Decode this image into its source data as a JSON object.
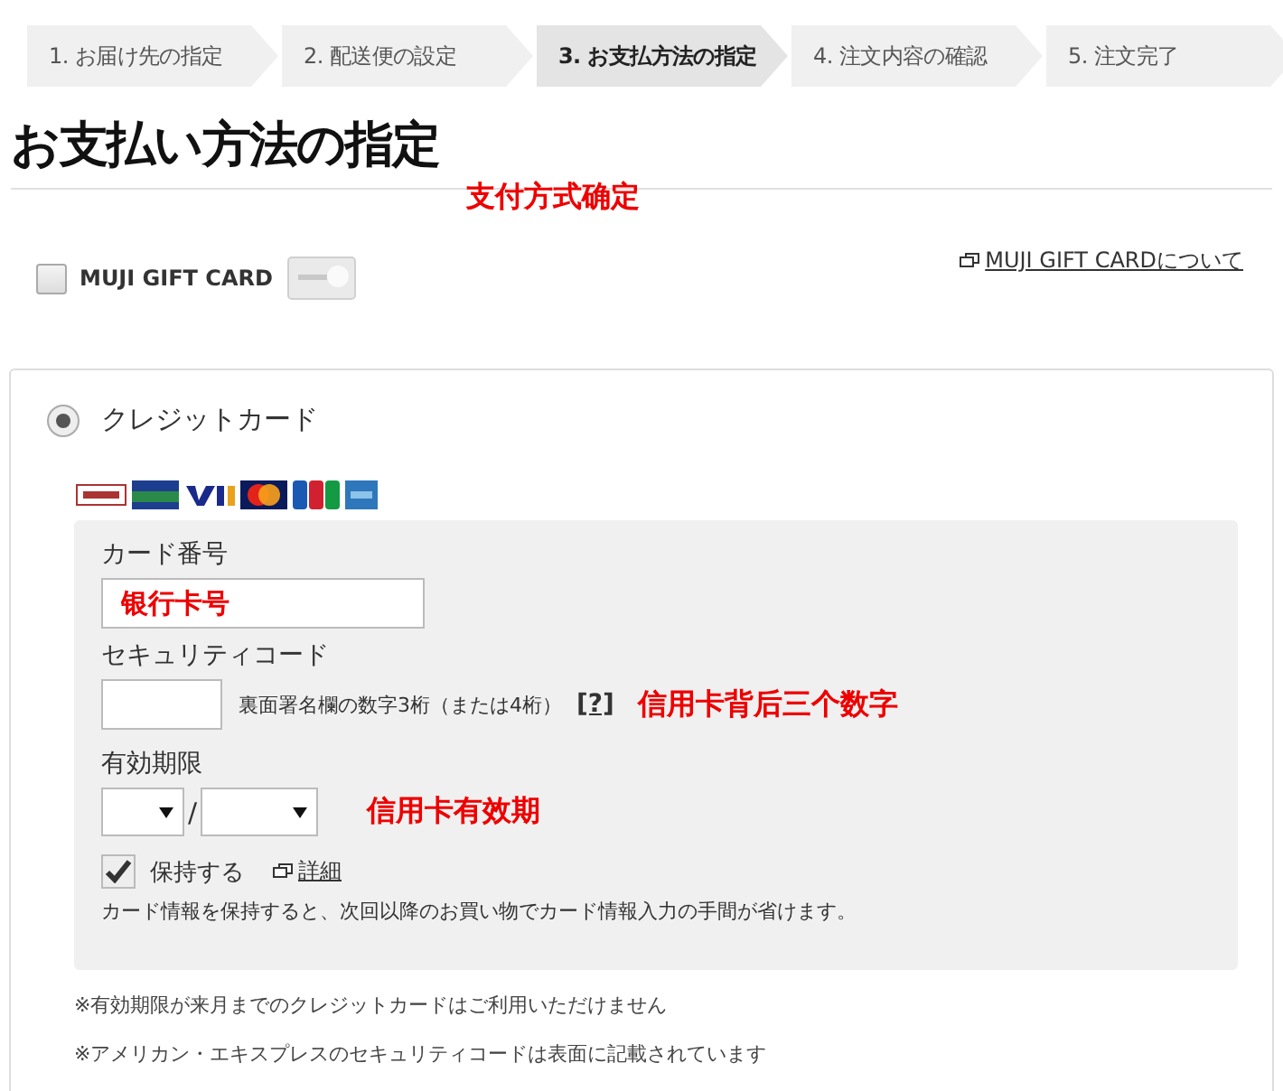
{
  "steps": [
    {
      "label": "1. お届け先の指定",
      "selected": false
    },
    {
      "label": "2. 配送便の設定",
      "selected": false
    },
    {
      "label": "3. お支払方法の指定",
      "selected": true
    },
    {
      "label": "4. 注文内容の確認",
      "selected": false
    },
    {
      "label": "5. 注文完了",
      "selected": false
    }
  ],
  "heading": "お支払い方法の指定",
  "heading_note": "支付方式确定",
  "gift_card": {
    "label": "MUJI GIFT CARD",
    "checked": false,
    "link": "MUJI GIFT CARDについて"
  },
  "payment": {
    "label": "クレジットカード",
    "selected": true,
    "card_number": {
      "label": "カード番号",
      "value": "银行卡号"
    },
    "security_code": {
      "label": "セキュリティコード",
      "hint": "裏面署名欄の数字3桁（または4桁）",
      "help": "[?]",
      "note": "信用卡背后三个数字"
    },
    "expiry": {
      "label": "有効期限",
      "separator": "/",
      "note": "信用卡有效期"
    },
    "remember": {
      "label": "保持する",
      "checked": true,
      "link": "詳細",
      "description": "カード情報を保持すると、次回以降のお買い物でカード情報入力の手間が省けます。"
    }
  },
  "notes": [
    "※有効期限が来月までのクレジットカードはご利用いただけません",
    "※アメリカン・エキスプレスのセキュリティコードは表面に記載されています"
  ]
}
